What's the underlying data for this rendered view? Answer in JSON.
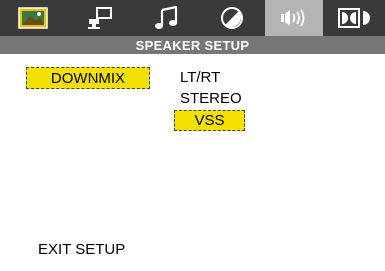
{
  "tabs": [
    {
      "icon": "picture-icon",
      "active": false
    },
    {
      "icon": "language-setup-icon",
      "active": false
    },
    {
      "icon": "music-note-icon",
      "active": false
    },
    {
      "icon": "contrast-icon",
      "active": false
    },
    {
      "icon": "speaker-icon",
      "active": true
    },
    {
      "icon": "dolby-icon",
      "active": false
    }
  ],
  "title": "SPEAKER SETUP",
  "menu": {
    "left_item": "DOWNMIX",
    "options": [
      "LT/RT",
      "STEREO",
      "VSS"
    ],
    "selected_option": "VSS"
  },
  "footer": {
    "exit_label": "EXIT SETUP"
  },
  "colors": {
    "tabbar": "#3a3a3a",
    "active_tab": "#b4b4b4",
    "titlebar": "#777777",
    "highlight": "#f2e000"
  }
}
